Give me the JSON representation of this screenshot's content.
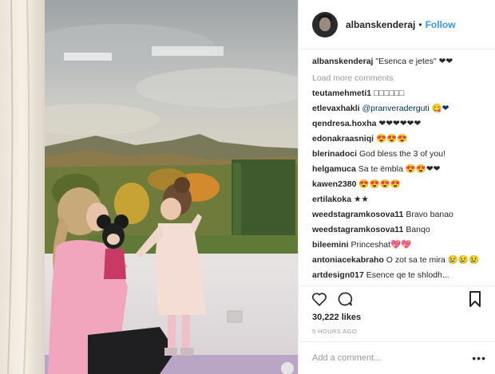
{
  "post": {
    "username": "albanskenderaj",
    "separator": "•",
    "follow_label": "Follow",
    "caption_user": "albanskenderaj",
    "caption_text": "\"Esenca e jetes\" ❤❤",
    "load_more": "Load more comments",
    "likes": "30,222 likes",
    "timestamp": "5 HOURS AGO",
    "comment_placeholder": "Add a comment...",
    "more_label": "•••"
  },
  "comments": [
    {
      "user": "teutamehmeti1",
      "text": "□□□□□□"
    },
    {
      "user": "etlevaxhakli",
      "text": "@pranveraderguti 😋❤"
    },
    {
      "user": "qendresa.hoxha",
      "text": "❤❤❤❤❤❤"
    },
    {
      "user": "edonakraasniqi",
      "text": "😍😍😍"
    },
    {
      "user": "blerinadoci",
      "text": "God bless the 3 of you!"
    },
    {
      "user": "helgamuca",
      "text": "Sa te ëmbla 😍😍❤❤"
    },
    {
      "user": "kawen2380",
      "text": "😍😍😍😍"
    },
    {
      "user": "ertilakoka",
      "text": "★★"
    },
    {
      "user": "weedstagramkosova11",
      "text": "Bravo banao"
    },
    {
      "user": "weedstagramkosova11",
      "text": "Banqo"
    },
    {
      "user": "bileemini",
      "text": "Princeshat💖💖"
    },
    {
      "user": "antoniacekabraho",
      "text": "O zot sa te mira 😢😢😢"
    },
    {
      "user": "artdesign017",
      "text": "Esence qe te shlodh..."
    }
  ],
  "icons": {
    "like": "heart-icon",
    "comment": "comment-icon",
    "save": "bookmark-icon"
  },
  "colors": {
    "accent": "#3897f0",
    "muted": "#999999",
    "text": "#262626"
  }
}
